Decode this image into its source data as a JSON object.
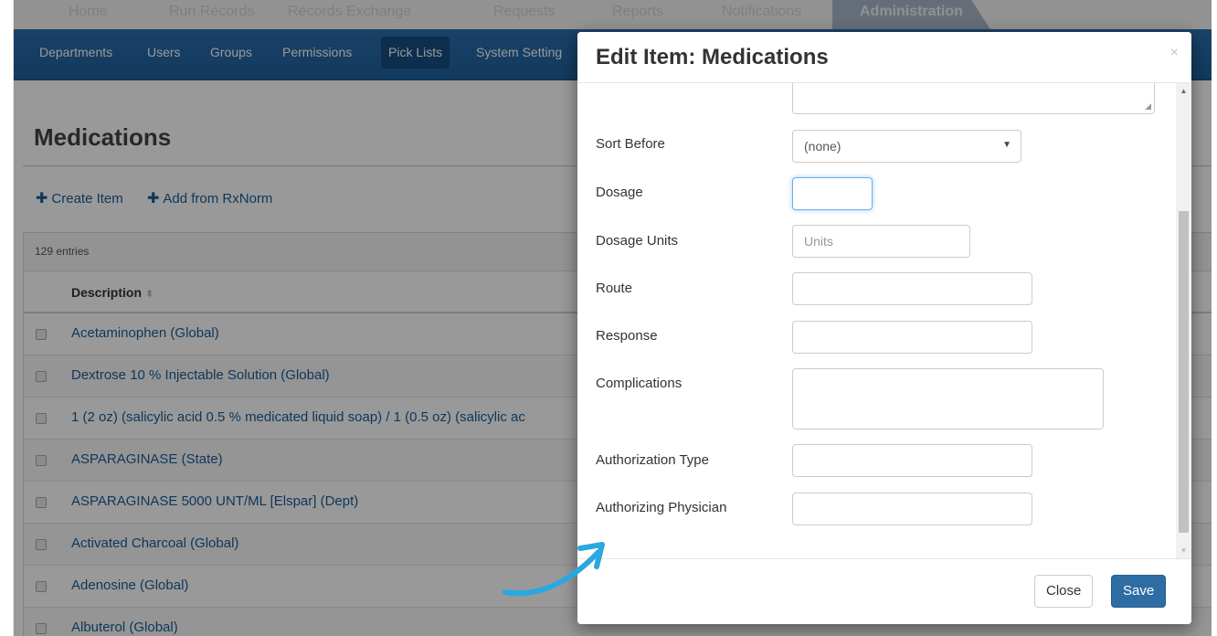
{
  "top_tabs": [
    "Home",
    "Run Records",
    "Records Exchange",
    "Requests",
    "Reports",
    "Notifications",
    "Administration"
  ],
  "subnav": [
    "Departments",
    "Users",
    "Groups",
    "Permissions",
    "Pick Lists",
    "System Setting"
  ],
  "page": {
    "title": "Medications",
    "create_label": "Create Item",
    "rxnorm_label": "Add from RxNorm",
    "entries": "129 entries",
    "column_header": "Description"
  },
  "rows": [
    "Acetaminophen (Global)",
    "Dextrose 10 % Injectable Solution (Global)",
    "1 (2 oz) (salicylic acid 0.5 % medicated liquid soap) / 1 (0.5 oz) (salicylic ac",
    "ASPARAGINASE (State)",
    "ASPARAGINASE 5000 UNT/ML [Elspar] (Dept)",
    "Activated Charcoal (Global)",
    "Adenosine (Global)",
    "Albuterol (Global)"
  ],
  "modal": {
    "title": "Edit Item: Medications",
    "close_x": "×",
    "fields": {
      "sort_before": {
        "label": "Sort Before",
        "value": "(none)"
      },
      "dosage": {
        "label": "Dosage"
      },
      "dosage_units": {
        "label": "Dosage Units",
        "placeholder": "Units"
      },
      "route": {
        "label": "Route"
      },
      "response": {
        "label": "Response"
      },
      "complications": {
        "label": "Complications"
      },
      "authorization_type": {
        "label": "Authorization Type"
      },
      "authorizing_physician": {
        "label": "Authorizing Physician"
      }
    },
    "close_button": "Close",
    "save_button": "Save"
  },
  "icons": {
    "plus": "plus-icon",
    "sort": "sort-icon",
    "close": "close-icon",
    "dropdown": "caret-down-icon",
    "annotation": "curved-arrow-icon"
  },
  "colors": {
    "nav_blue": "#1f5f9c",
    "link_blue": "#1a5d97",
    "save_blue": "#2e6da4",
    "annotation_cyan": "#2aa8e0"
  }
}
